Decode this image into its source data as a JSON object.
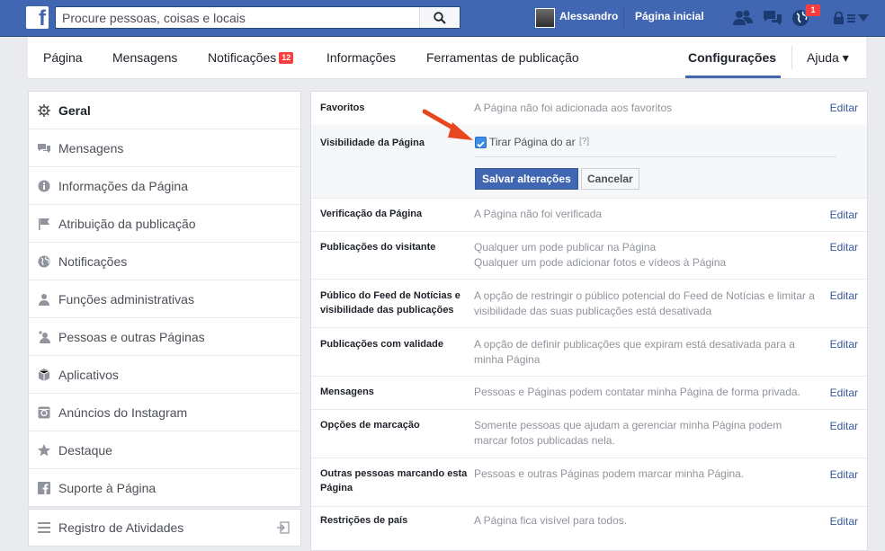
{
  "topbar": {
    "logo": "f",
    "search_placeholder": "Procure pessoas, coisas e locais",
    "user_name": "Alessandro",
    "home_label": "Página inicial",
    "notification_count": "1",
    "icons": [
      "search-icon",
      "friends-icon",
      "messages-icon",
      "globe-icon",
      "lock-icon",
      "chevron-down-icon"
    ]
  },
  "page_nav": {
    "tabs": [
      {
        "label": "Página"
      },
      {
        "label": "Mensagens"
      },
      {
        "label": "Notificações",
        "badge": "12"
      },
      {
        "label": "Informações"
      },
      {
        "label": "Ferramentas de publicação"
      },
      {
        "label": "Configurações",
        "active": true
      },
      {
        "label": "Ajuda ▾"
      }
    ]
  },
  "sidebar": {
    "items": [
      {
        "label": "Geral",
        "icon": "gear-icon",
        "active": true
      },
      {
        "label": "Mensagens",
        "icon": "chat-icon"
      },
      {
        "label": "Informações da Página",
        "icon": "info-icon"
      },
      {
        "label": "Atribuição da publicação",
        "icon": "flag-icon"
      },
      {
        "label": "Notificações",
        "icon": "globe-icon"
      },
      {
        "label": "Funções administrativas",
        "icon": "person-icon"
      },
      {
        "label": "Pessoas e outras Páginas",
        "icon": "person-add-icon"
      },
      {
        "label": "Aplicativos",
        "icon": "cube-icon"
      },
      {
        "label": "Anúncios do Instagram",
        "icon": "instagram-icon"
      },
      {
        "label": "Destaque",
        "icon": "star-icon"
      },
      {
        "label": "Suporte à Página",
        "icon": "facebook-icon"
      }
    ],
    "activity_log": {
      "label": "Registro de Atividades",
      "icon": "list-icon"
    }
  },
  "settings": {
    "edit_label": "Editar",
    "rows": [
      {
        "label": "Favoritos",
        "value": "A Página não foi adicionada aos favoritos"
      },
      {
        "label": "Visibilidade da Página",
        "checkbox_label": "Tirar Página do ar",
        "help": "[?]",
        "checkbox_checked": true,
        "save_label": "Salvar alterações",
        "cancel_label": "Cancelar"
      },
      {
        "label": "Verificação da Página",
        "value": "A Página não foi verificada"
      },
      {
        "label": "Publicações do visitante",
        "value": "Qualquer um pode publicar na Página",
        "value2": "Qualquer um pode adicionar fotos e vídeos à Página"
      },
      {
        "label": "Público do Feed de Notícias e visibilidade das publicações",
        "value": "A opção de restringir o público potencial do Feed de Notícias e limitar a visibilidade das suas publicações está desativada"
      },
      {
        "label": "Publicações com validade",
        "value": "A opção de definir publicações que expiram está desativada para a minha Página"
      },
      {
        "label": "Mensagens",
        "value": "Pessoas e Páginas podem contatar minha Página de forma privada."
      },
      {
        "label": "Opções de marcação",
        "value": "Somente pessoas que ajudam a gerenciar minha Página podem marcar fotos publicadas nela."
      },
      {
        "label": "Outras pessoas marcando esta Página",
        "value": "Pessoas e outras Páginas podem marcar minha Página."
      },
      {
        "label": "Restrições de país",
        "value": "A Página fica visível para todos."
      }
    ]
  },
  "colors": {
    "brand": "#4267b2",
    "link": "#365899",
    "badge": "#fa3e3e",
    "arrow": "#e8461e"
  }
}
